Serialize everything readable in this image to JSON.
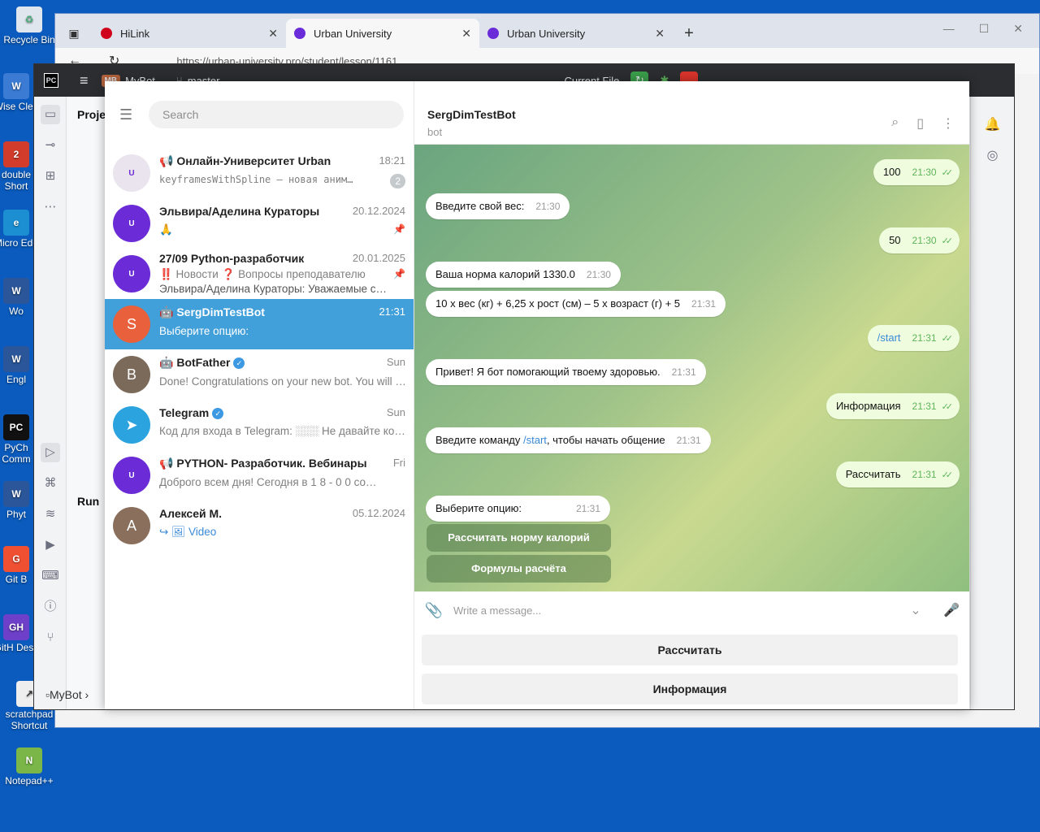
{
  "desktop": {
    "icons": [
      {
        "label": "Recycle Bin",
        "abbr": "♻",
        "color": "#dfe6ee"
      },
      {
        "label": "Wise Clea",
        "abbr": "W",
        "color": "#3b7bd4"
      },
      {
        "label": "double Short",
        "abbr": "2",
        "color": "#d23c2a"
      },
      {
        "label": "Micro Edg",
        "abbr": "e",
        "color": "#1b8fd2"
      },
      {
        "label": "Wo",
        "abbr": "W",
        "color": "#2b579a"
      },
      {
        "label": "Engl",
        "abbr": "W",
        "color": "#2b579a"
      },
      {
        "label": "PyCh Comm",
        "abbr": "PC",
        "color": "#111"
      },
      {
        "label": "Phyt",
        "abbr": "W",
        "color": "#2b579a"
      },
      {
        "label": "Git B",
        "abbr": "G",
        "color": "#f05032"
      },
      {
        "label": "GitH Desk",
        "abbr": "GH",
        "color": "#6e40c9"
      },
      {
        "label": "scratchpad Shortcut",
        "abbr": "↗",
        "color": "#eee"
      },
      {
        "label": "Notepad++",
        "abbr": "N",
        "color": "#7ab648"
      }
    ]
  },
  "browser": {
    "tabs": [
      {
        "title": "HiLink",
        "icon_color": "#d0021b"
      },
      {
        "title": "Urban University",
        "icon_color": "#6a2bd9"
      },
      {
        "title": "Urban University",
        "icon_color": "#6a2bd9"
      }
    ],
    "url": "https://urban-university.pro/student/lesson/1161"
  },
  "pycharm": {
    "project": "MyBot",
    "branch": "master",
    "run_config": "Current File",
    "projects_label": "Proje",
    "run_label": "Run",
    "breadcrumb": "MyBot"
  },
  "telegram": {
    "search_placeholder": "Search",
    "chats": [
      {
        "name": "📢 Онлайн-Университет Urban",
        "time": "18:21",
        "last": "keyframesWithSpline — новая аним…",
        "badge": "2",
        "avatar_color": "#e9e4ee",
        "avatar_text": "U"
      },
      {
        "name": "Эльвира/Аделина Кураторы",
        "time": "20.12.2024",
        "last": "🙏",
        "pin": "📌",
        "avatar_color": "#6b2bd6",
        "avatar_text": "U"
      },
      {
        "name": "27/09 Python-разработчик",
        "time": "20.01.2025",
        "last": "‼️ Новости ❓ Вопросы преподавателю",
        "last2": "Эльвира/Аделина Кураторы: Уважаемые с…",
        "pin": "📌",
        "avatar_color": "#6b2bd6",
        "avatar_text": "U"
      },
      {
        "name": "SergDimTestBot",
        "time": "21:31",
        "last": "Выберите опцию:",
        "avatar_color": "#e8603c",
        "avatar_text": "S",
        "selected": true
      },
      {
        "name": "BotFather",
        "time": "Sun",
        "last": "Done! Congratulations on your new bot. You will …",
        "verified": true,
        "avatar_color": "#7b6a5a",
        "avatar_text": "B"
      },
      {
        "name": "Telegram",
        "time": "Sun",
        "last": "Код для входа в Telegram: ░░░ Не давайте ко…",
        "verified": true,
        "avatar_color": "#2aa3df",
        "avatar_text": "➤"
      },
      {
        "name": "📢 PYTHON- Разработчик. Вебинары",
        "time": "Fri",
        "last": "Доброго всем дня! Сегодня в 1 8 - 0 0 со…",
        "avatar_color": "#6b2bd6",
        "avatar_text": "U"
      },
      {
        "name": "Алексей М.",
        "time": "05.12.2024",
        "last": "↪ 🖼 Video",
        "avatar_color": "#8a6f5c",
        "avatar_text": "А"
      }
    ],
    "header": {
      "name": "SergDimTestBot",
      "status": "bot"
    },
    "messages": [
      {
        "text": "100",
        "time": "21:30",
        "out": true
      },
      {
        "text": "Введите свой вес:",
        "time": "21:30",
        "out": false
      },
      {
        "text": "50",
        "time": "21:30",
        "out": true
      },
      {
        "text": "Ваша норма калорий 1330.0",
        "time": "21:30",
        "out": false
      },
      {
        "text": "10 х вес (кг) + 6,25 x рост (см) – 5 х возраст (г) + 5",
        "time": "21:31",
        "out": false
      },
      {
        "text": "/start",
        "time": "21:31",
        "out": true
      },
      {
        "text": "Привет! Я бот помогающий твоему здоровью.",
        "time": "21:31",
        "out": false
      },
      {
        "text": "Информация",
        "time": "21:31",
        "out": true
      },
      {
        "text_a": "Введите команду ",
        "text_link": "/start",
        "text_b": ", чтобы начать общение",
        "time": "21:31",
        "out": false
      },
      {
        "text": "Рассчитать",
        "time": "21:31",
        "out": true
      },
      {
        "text": "Выберите опцию:",
        "time": "21:31",
        "out": false
      }
    ],
    "inline_buttons": [
      "Рассчитать норму калорий",
      "Формулы расчёта"
    ],
    "composer_placeholder": "Write a message...",
    "reply_keyboard": [
      "Рассчитать",
      "Информация"
    ]
  }
}
